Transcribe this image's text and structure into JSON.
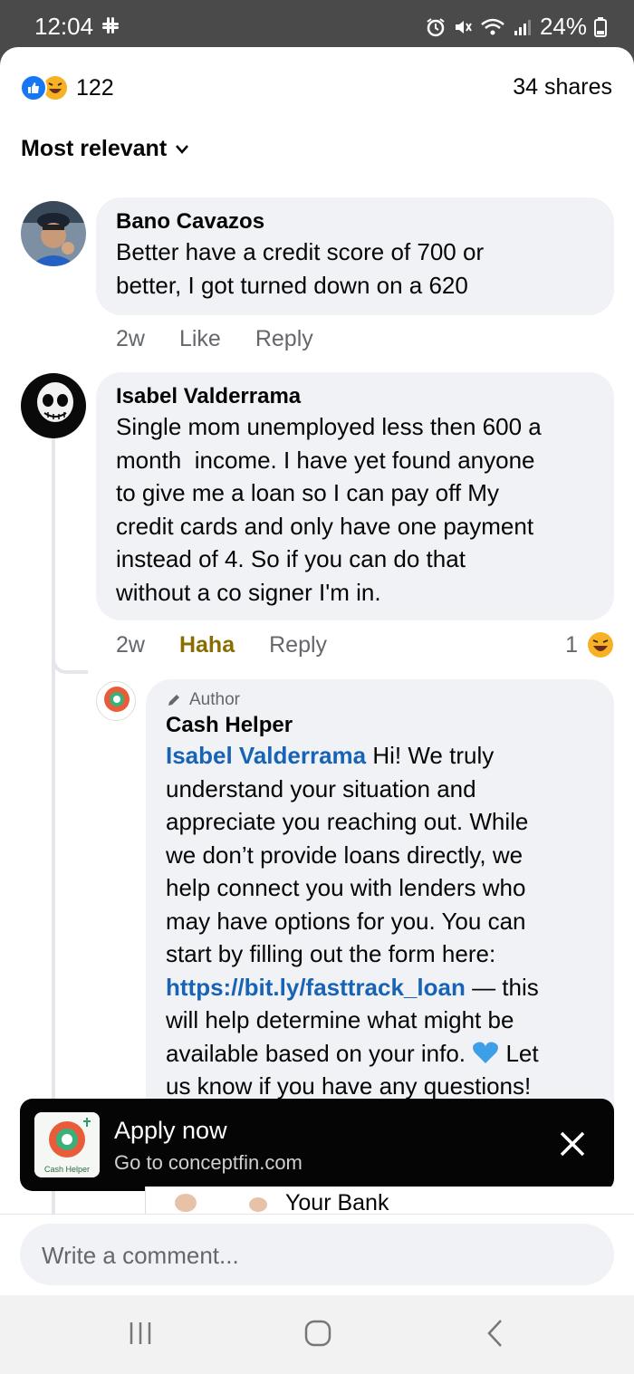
{
  "status": {
    "time": "12:04",
    "battery": "24%"
  },
  "summary": {
    "reaction_count": "122",
    "shares": "34 shares"
  },
  "sort": {
    "label": "Most relevant"
  },
  "comments": [
    {
      "author": "Bano Cavazos",
      "text_lines": [
        "Better have a credit score of 700 or",
        "better, I got turned down on a 620"
      ],
      "time": "2w",
      "like": "Like",
      "reply": "Reply"
    },
    {
      "author": "Isabel Valderrama",
      "text_lines": [
        "Single mom unemployed less then 600 a",
        "month  income. I have yet found anyone",
        "to give me a loan so I can pay off My",
        "credit cards and only have one payment",
        "instead of 4. So if you can do that",
        "without a co signer I'm in."
      ],
      "time": "2w",
      "reaction_label": "Haha",
      "reply": "Reply",
      "reaction_count": "1"
    }
  ],
  "reply": {
    "badge": "Author",
    "author": "Cash Helper",
    "mention": "Isabel Valderrama",
    "line1_rest": " Hi! We truly",
    "lines": [
      "understand your situation and",
      "appreciate you reaching out. While",
      "we don’t provide loans directly, we",
      "help connect you with lenders who",
      "may have options for you. You can",
      "start by filling out the form here:"
    ],
    "link": "https://bit.ly/fasttrack_loan",
    "after_link": " — this",
    "lines2": [
      "will help determine what might be"
    ],
    "line_heart_before": "available based on your info. ",
    "line_heart_after": " Let",
    "last_line": "us know if you have any questions!",
    "avatar_caption": "Cash Helper"
  },
  "ad": {
    "title": "Apply now",
    "subtitle": "Go to conceptfin.com",
    "thumb_caption": "Cash Helper",
    "below_text": "Your Bank"
  },
  "composer": {
    "placeholder": "Write a comment..."
  },
  "colors": {
    "accent": "#1877f2",
    "link": "#1763b5",
    "haha": "#8a6d00"
  }
}
